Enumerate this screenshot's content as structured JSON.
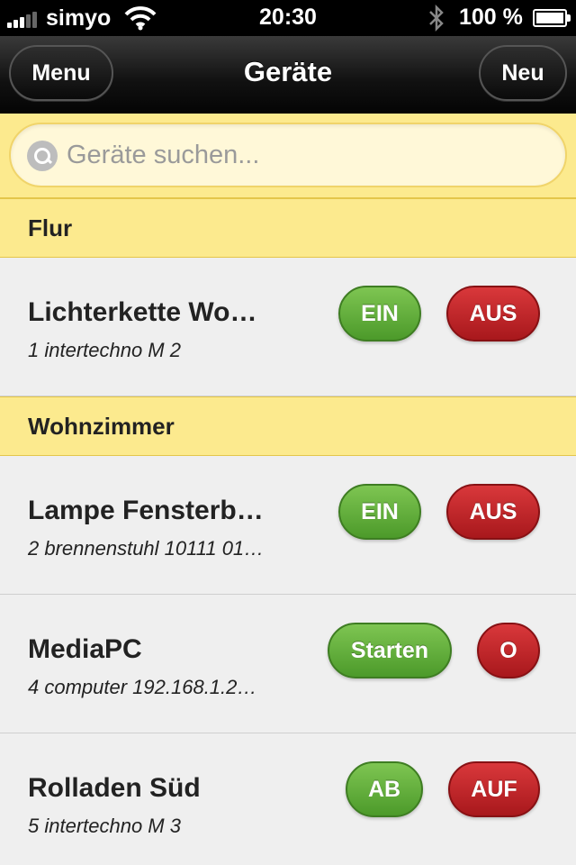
{
  "status_bar": {
    "carrier": "simyo",
    "time": "20:30",
    "battery": "100 %"
  },
  "navbar": {
    "title": "Geräte",
    "left_button": "Menu",
    "right_button": "Neu"
  },
  "search": {
    "placeholder": "Geräte suchen..."
  },
  "sections": [
    {
      "title": "Flur",
      "devices": [
        {
          "name": "Lichterkette Wo…",
          "detail": "1 intertechno M 2",
          "buttons": [
            "EIN",
            "AUS"
          ]
        }
      ]
    },
    {
      "title": "Wohnzimmer",
      "devices": [
        {
          "name": "Lampe Fensterb…",
          "detail": "2 brennenstuhl 10111 01…",
          "buttons": [
            "EIN",
            "AUS"
          ]
        },
        {
          "name": "MediaPC",
          "detail": "4 computer 192.168.1.2…",
          "buttons": [
            "Starten",
            "O"
          ]
        },
        {
          "name": "Rolladen Süd",
          "detail": "5 intertechno M 3",
          "buttons": [
            "AB",
            "AUF"
          ]
        }
      ]
    }
  ],
  "colors": {
    "section_bg": "#fcea8e",
    "on_button": "#5ca936",
    "off_button": "#c0262a",
    "navbar": "#111111"
  }
}
